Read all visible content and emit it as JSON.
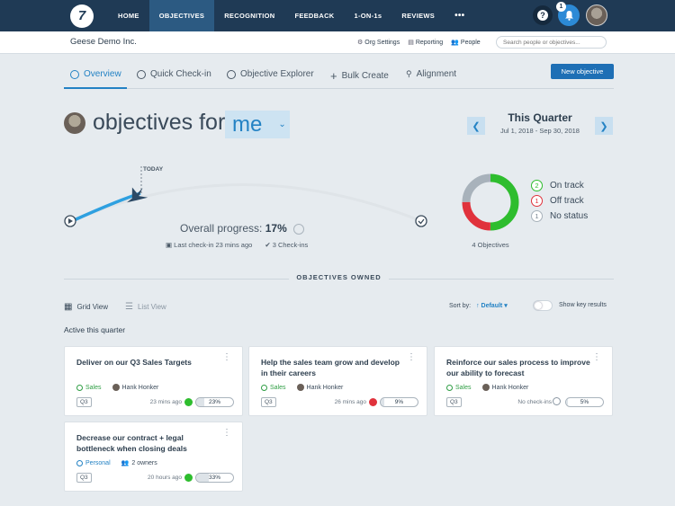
{
  "nav": {
    "logo": "7",
    "items": [
      "HOME",
      "OBJECTIVES",
      "RECOGNITION",
      "FEEDBACK",
      "1-ON-1s",
      "REVIEWS",
      "•••"
    ],
    "active": "OBJECTIVES",
    "help": "?",
    "notification_count": "1"
  },
  "subbar": {
    "company": "Geese Demo Inc.",
    "links": [
      "Org Settings",
      "Reporting",
      "People"
    ],
    "search_placeholder": "Search people or objectives..."
  },
  "tabs": [
    "Overview",
    "Quick Check-in",
    "Objective Explorer",
    "Bulk Create",
    "Alignment"
  ],
  "new_objective": "New objective",
  "header": {
    "prefix": "objectives for",
    "who": "me",
    "quarter_title": "This Quarter",
    "quarter_dates": "Jul 1, 2018 - Sep 30, 2018",
    "prev": "❮",
    "next": "❯"
  },
  "progress": {
    "today": "TODAY",
    "label": "Overall progress:",
    "value": "17%",
    "last_checkin": "Last check-in 23 mins ago",
    "checkins": "3 Check-ins",
    "fraction": 0.17
  },
  "status": {
    "objectives_label": "4 Objectives",
    "legend": [
      {
        "count": "2",
        "label": "On track",
        "color": "#2ebd2e"
      },
      {
        "count": "1",
        "label": "Off track",
        "color": "#e0323c"
      },
      {
        "count": "1",
        "label": "No status",
        "color": "#a8b2bb"
      }
    ]
  },
  "section": {
    "owned_label": "OBJECTIVES OWNED",
    "grid_view": "Grid View",
    "list_view": "List View",
    "sort_by": "Sort by:",
    "sort_default": "Default",
    "show_key_results": "Show key results",
    "active_quarter": "Active this quarter"
  },
  "cards": [
    {
      "title": "Deliver on our Q3 Sales Targets",
      "tag": "Sales",
      "owner": "Hank Honker",
      "quarter": "Q3",
      "time": "23 mins ago",
      "status_color": "#2ebd2e",
      "progress": "23%"
    },
    {
      "title": "Help the sales team grow and develop in their careers",
      "tag": "Sales",
      "owner": "Hank Honker",
      "quarter": "Q3",
      "time": "26 mins ago",
      "status_color": "#e0323c",
      "progress": "9%"
    },
    {
      "title": "Reinforce our sales process to improve our ability to forecast",
      "tag": "Sales",
      "owner": "Hank Honker",
      "quarter": "Q3",
      "time": "No check-ins",
      "status_color": "none",
      "progress": "5%"
    },
    {
      "title": "Decrease our contract + legal bottleneck when closing deals",
      "tag": "Personal",
      "owner": "2 owners",
      "quarter": "Q3",
      "time": "20 hours ago",
      "status_color": "#2ebd2e",
      "progress": "33%"
    }
  ]
}
